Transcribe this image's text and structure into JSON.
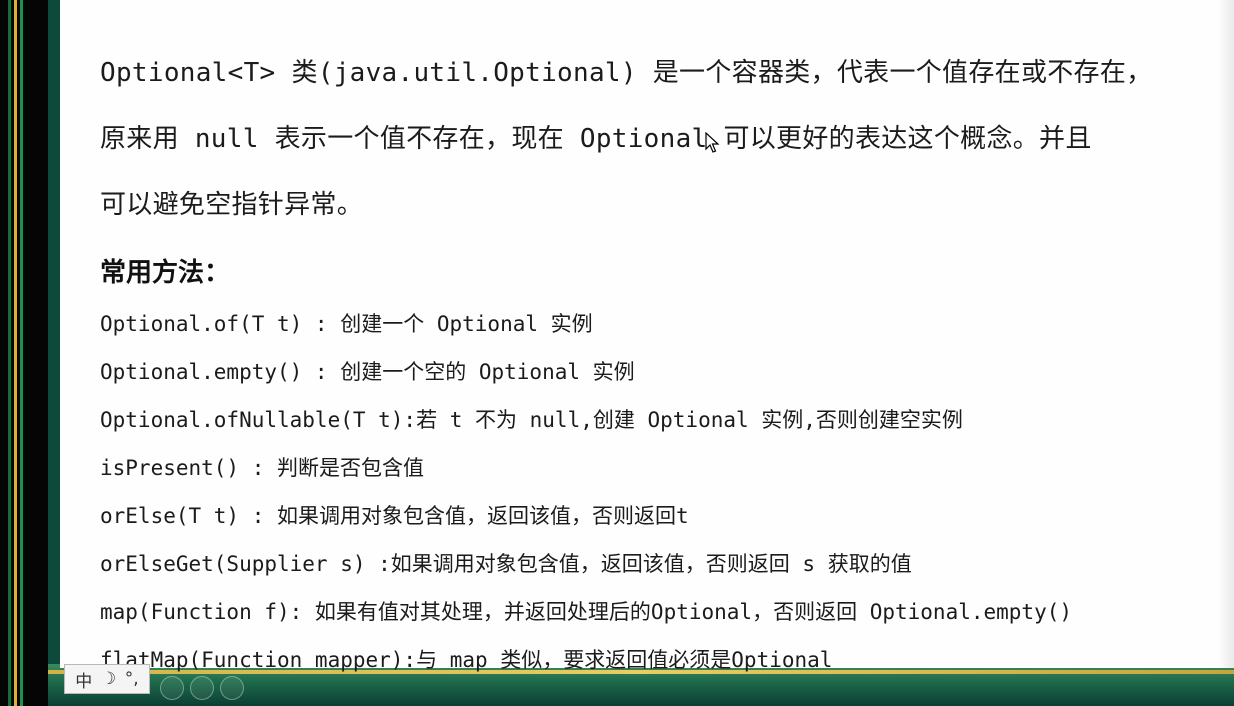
{
  "slide": {
    "intro_lines": [
      "Optional<T> 类(java.util.Optional) 是一个容器类，代表一个值存在或不存在，",
      "原来用 null 表示一个值不存在，现在 Optional 可以更好的表达这个概念。并且",
      "可以避免空指针异常。"
    ],
    "heading": "常用方法：",
    "methods": [
      "Optional.of(T t) : 创建一个 Optional 实例",
      "Optional.empty() : 创建一个空的 Optional 实例",
      "Optional.ofNullable(T t):若 t 不为 null,创建 Optional 实例,否则创建空实例",
      "isPresent() : 判断是否包含值",
      "orElse(T t) :  如果调用对象包含值，返回该值，否则返回t",
      "orElseGet(Supplier s) :如果调用对象包含值，返回该值，否则返回 s 获取的值",
      "map(Function f): 如果有值对其处理，并返回处理后的Optional，否则返回 Optional.empty()",
      "flatMap(Function mapper):与 map 类似，要求返回值必须是Optional"
    ]
  },
  "ime_toolbar": {
    "mode": "中",
    "moon": "☽",
    "punct": "°,"
  },
  "colors": {
    "text": "#1b1b1b",
    "frame_green": "#0d4a3c",
    "frame_gold": "#d4b24a"
  },
  "icons": [
    "mouse-pointer-icon",
    "moon-icon"
  ]
}
